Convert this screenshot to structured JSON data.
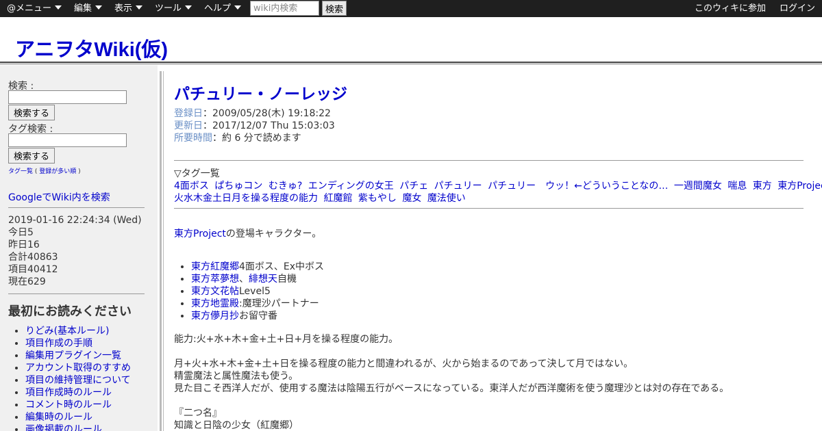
{
  "topbar": {
    "menus": [
      "@メニュー",
      "編集",
      "表示",
      "ツール",
      "ヘルプ"
    ],
    "search_placeholder": "wiki内検索",
    "search_button": "検索",
    "join": "このウィキに参加",
    "login": "ログイン"
  },
  "site": {
    "title": "アニヲタWiki(仮)"
  },
  "sidebar": {
    "search_label": "検索 :",
    "search_button": "検索する",
    "tag_search_label": "タグ検索 :",
    "tag_search_button": "検索する",
    "tag_list": "タグ一覧",
    "tag_popular": "登録が多い順",
    "google_search": "GoogleでWiki内を検索",
    "stats": {
      "datetime": "2019-01-16 22:24:34 (Wed)",
      "today": "今日5",
      "yesterday": "昨日16",
      "total": "合計40863",
      "items": "項目40412",
      "current": "現在629"
    },
    "read_first_title": "最初にお読みください",
    "read_first_items": [
      "りどみ(基本ルール)",
      "項目作成の手順",
      "編集用プラグイン一覧",
      "アカウント取得のすすめ",
      "項目の維持管理について",
      "項目作成時のルール",
      "コメント時のルール",
      "編集時のルール",
      "画像掲載のルール"
    ]
  },
  "article": {
    "title": "パチュリー・ノーレッジ",
    "registered_label": "登録日",
    "registered": "：2009/05/28(木) 19:18:22",
    "updated_label": "更新日",
    "updated": "：2017/12/07 Thu 15:03:03",
    "readtime_label": "所要時間",
    "readtime": "：約 6 分で読めます",
    "tags_heading": "▽タグ一覧",
    "tags_row1": [
      "4面ボス",
      "ぱちゅコン",
      "むきゅ?",
      "エンディングの女王",
      "パチェ",
      "パチュリー",
      "パチュリー　ウッ！←どういうことなの…",
      "一週間魔女",
      "喘息",
      "東方",
      "東方Project"
    ],
    "tags_row2": [
      "火水木金土日月を操る程度の能力",
      "紅魔館",
      "紫もやし",
      "魔女",
      "魔法使い"
    ],
    "intro_link": "東方Project",
    "intro_text": "の登場キャラクター。",
    "works": [
      {
        "link": "東方紅魔郷",
        "text": "4面ボス、Ex中ボス"
      },
      {
        "link": "東方萃夢想",
        "sep": "、",
        "link2": "緋想天",
        "text": "自機"
      },
      {
        "link": "東方文花帖",
        "text": "Level5"
      },
      {
        "link": "東方地霊殿",
        "text": ":魔理沙パートナー"
      },
      {
        "link": "東方儚月抄",
        "text": "お留守番"
      }
    ],
    "ability": "能力:火+水+木+金+土+日+月を操る程度の能力。",
    "para1": "月+火+水+木+金+土+日を操る程度の能力と間違われるが、火から始まるのであって決して月ではない。",
    "para2": "精霊魔法と属性魔法も使う。",
    "para3": "見た目こそ西洋人だが、使用する魔法は陰陽五行がベースになっている。東洋人だが西洋魔術を使う魔理沙とは対の存在である。",
    "nickname_head": "『二つ名』",
    "nickname_1": "知識と日陰の少女（紅魔郷）"
  }
}
